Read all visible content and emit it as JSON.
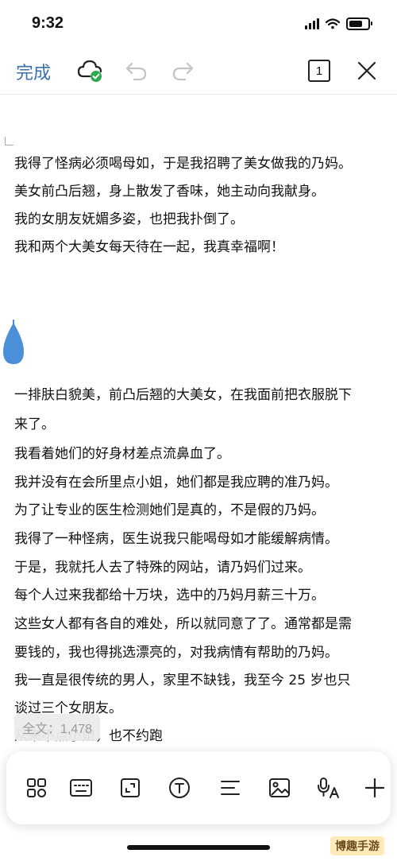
{
  "status": {
    "time": "9:32",
    "battery_level": 0.8
  },
  "toolbar": {
    "done_label": "完成",
    "page_number": "1"
  },
  "document": {
    "paragraphs_top": [
      "我得了怪病必须喝母如，于是我招聘了美女做我的乃妈。",
      "美女前凸后翘，身上散发了香味，她主动向我献身。",
      "我的女朋友妩媚多姿，也把我扑倒了。",
      "我和两个大美女每天待在一起，我真幸福啊！"
    ],
    "paragraphs_bottom": [
      "一排肤白貌美，前凸后翘的大美女，在我面前把衣服脱下",
      "来了。",
      "我看着她们的好身材差点流鼻血了。",
      "我并没有在会所里点小姐，她们都是我应聘的准乃妈。",
      "为了让专业的医生检测她们是真的，不是假的乃妈。",
      "我得了一种怪病，医生说我只能喝母如才能缓解病情。",
      "于是，我就托人去了特殊的网站，请乃妈们过来。",
      "每个人过来我都给十万块，选中的乃妈月薪三十万。",
      "这些女人都有各自的难处，所以就同意了了。通常都是需",
      "要钱的，我也得挑选漂亮的，对我病情有帮助的乃妈。",
      "我一直是很传统的男人，家里不缺钱，我至今 25 岁也只",
      "谈过三个女朋友。",
      "从来不点小姐，也不约跑"
    ],
    "word_count_label": "全文：1,478"
  },
  "watermark": "博趣手游",
  "colors": {
    "accent": "#3a6fb0",
    "cursor": "#4a8fd8",
    "cloud_ok": "#2fa84f"
  }
}
